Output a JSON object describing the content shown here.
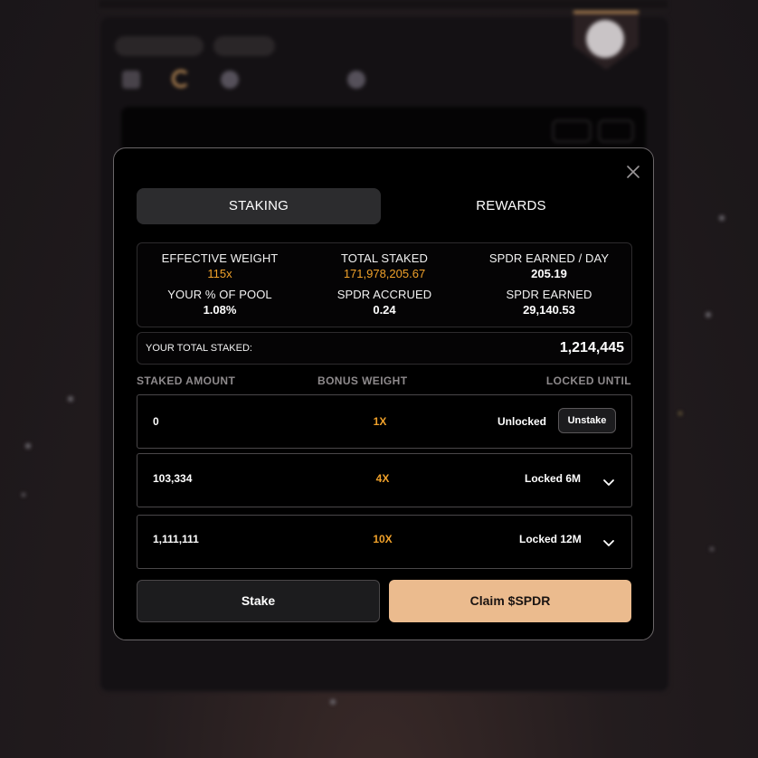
{
  "modal": {
    "tabs": [
      {
        "label": "STAKING"
      },
      {
        "label": "REWARDS"
      }
    ],
    "stats": {
      "effective_weight": {
        "label": "EFFECTIVE WEIGHT",
        "value": "115x"
      },
      "total_staked": {
        "label": "TOTAL STAKED",
        "value": "171,978,205.67"
      },
      "spdr_earned_day": {
        "label": "SPDR EARNED / DAY",
        "value": "205.19"
      },
      "pool_percent": {
        "label": "YOUR % OF POOL",
        "value": "1.08%"
      },
      "spdr_accrued": {
        "label": "SPDR ACCRUED",
        "value": "0.24"
      },
      "spdr_earned": {
        "label": "SPDR EARNED",
        "value": "29,140.53"
      }
    },
    "total_staked_row": {
      "label": "YOUR TOTAL STAKED:",
      "value": "1,214,445"
    },
    "table": {
      "headers": [
        "STAKED AMOUNT",
        "BONUS WEIGHT",
        "LOCKED UNTIL"
      ],
      "rows": [
        {
          "amount": "0",
          "weight": "1X",
          "lock": "Unlocked",
          "action": "Unstake"
        },
        {
          "amount": "103,334",
          "weight": "4X",
          "lock": "Locked 6M"
        },
        {
          "amount": "1,111,111",
          "weight": "10X",
          "lock": "Locked 12M"
        }
      ]
    },
    "buttons": {
      "stake": "Stake",
      "claim": "Claim $SPDR"
    },
    "icons": {
      "close": "close-icon",
      "expand": "chevron-down-icon"
    },
    "colors": {
      "accent_gold": "#f0a12a",
      "claim_button": "#ebbb8e",
      "active_tab": "#2c2c2e"
    }
  }
}
